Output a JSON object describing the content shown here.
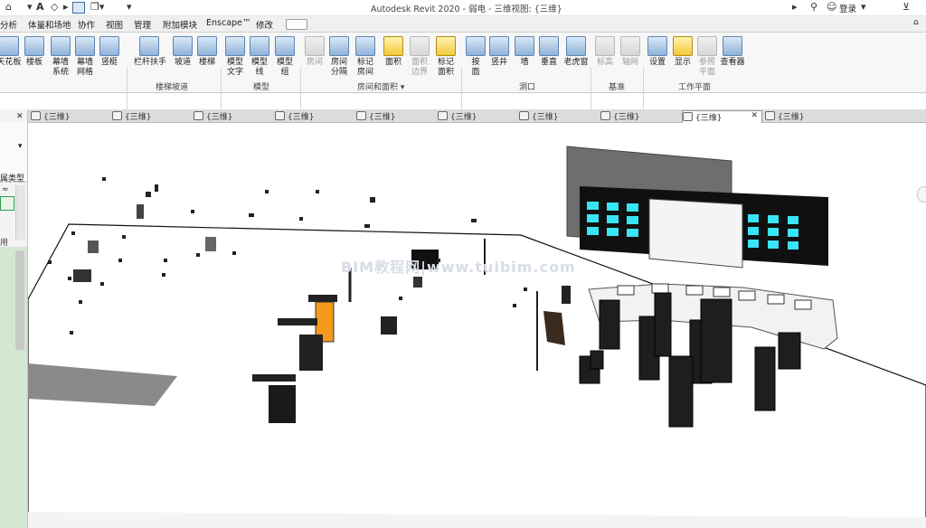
{
  "title_bar": {
    "title": "Autodesk Revit 2020 - 弱电 - 三维视图: {三维}",
    "quick_access_text_a": "A",
    "login": "登录",
    "help": "?"
  },
  "menu": {
    "items": [
      "分析",
      "体量和场地",
      "协作",
      "视图",
      "管理",
      "附加模块",
      "Enscape™",
      "修改"
    ]
  },
  "ribbon": {
    "buttons": [
      {
        "label": "天花板",
        "state": "normal"
      },
      {
        "label": "楼板",
        "state": "normal"
      },
      {
        "label": "幕墙\n系统",
        "state": "normal"
      },
      {
        "label": "幕墙\n网格",
        "state": "normal"
      },
      {
        "label": "竖梃",
        "state": "normal"
      },
      {
        "label": "栏杆扶手",
        "state": "normal"
      },
      {
        "label": "坡道",
        "state": "normal"
      },
      {
        "label": "楼梯",
        "state": "normal"
      },
      {
        "label": "模型\n文字",
        "state": "normal"
      },
      {
        "label": "模型\n线",
        "state": "normal"
      },
      {
        "label": "模型\n组",
        "state": "normal"
      },
      {
        "label": "房间",
        "state": "disabled"
      },
      {
        "label": "房间\n分隔",
        "state": "normal"
      },
      {
        "label": "标记\n房间",
        "state": "normal"
      },
      {
        "label": "面积",
        "state": "normal"
      },
      {
        "label": "面积\n边界",
        "state": "disabled"
      },
      {
        "label": "标记\n面积",
        "state": "normal"
      },
      {
        "label": "按\n面",
        "state": "normal"
      },
      {
        "label": "竖井",
        "state": "normal"
      },
      {
        "label": "墙",
        "state": "normal"
      },
      {
        "label": "垂直",
        "state": "normal"
      },
      {
        "label": "老虎窗",
        "state": "normal"
      },
      {
        "label": "标高",
        "state": "disabled"
      },
      {
        "label": "轴网",
        "state": "disabled"
      },
      {
        "label": "设置",
        "state": "normal"
      },
      {
        "label": "显示",
        "state": "normal"
      },
      {
        "label": "参照\n平面",
        "state": "disabled"
      },
      {
        "label": "查看器",
        "state": "normal"
      }
    ],
    "groups": [
      "楼梯坡道",
      "模型",
      "房间和面积 ▾",
      "洞口",
      "基准",
      "工作平面"
    ]
  },
  "view_tabs": {
    "tabs": [
      "{三维}",
      "{三维}",
      "{三维}",
      "{三维}",
      "{三维}",
      "{三维}",
      "{三维}",
      "{三维}",
      "{三维}",
      "{三维}"
    ],
    "active_index": 8
  },
  "left_panel": {
    "label1": "属类型",
    "label2": "用"
  },
  "viewport": {
    "watermark": "BIM教程网|www.tuibim.com"
  }
}
